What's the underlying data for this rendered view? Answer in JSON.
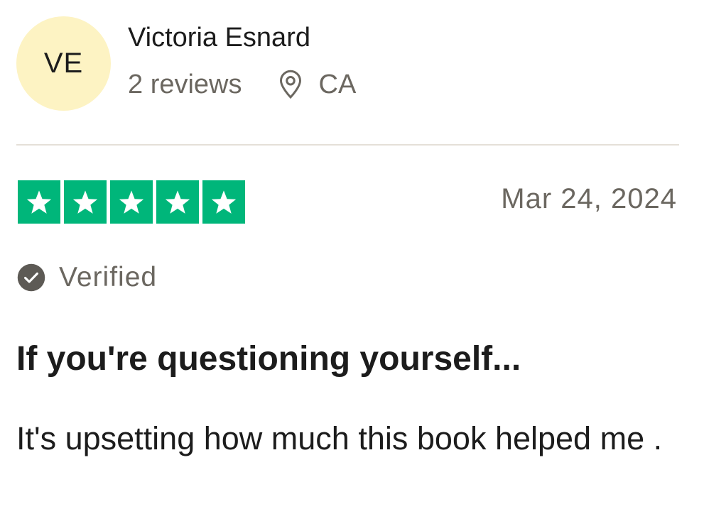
{
  "reviewer": {
    "initials": "VE",
    "name": "Victoria Esnard",
    "reviews_count": "2 reviews",
    "location": "CA",
    "avatar_color": "#fdf3c3"
  },
  "review": {
    "rating": 5,
    "max_rating": 5,
    "star_color": "#00b67a",
    "date": "Mar 24, 2024",
    "verified_label": "Verified",
    "title": "If you're questioning yourself...",
    "body": "It's upsetting how much this book helped me ."
  },
  "icons": {
    "location": "map-pin-icon",
    "verified": "check-circle-icon",
    "star": "star-icon"
  }
}
